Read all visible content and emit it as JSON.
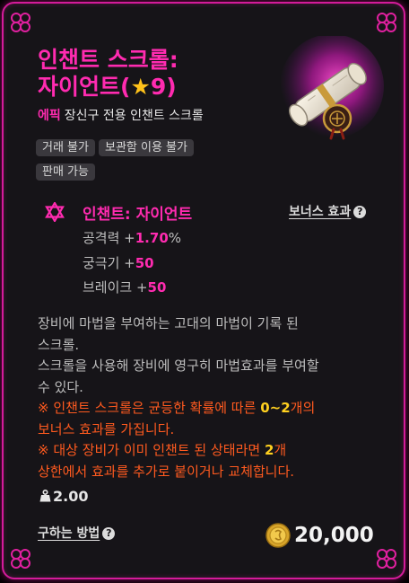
{
  "item": {
    "title_line1": "인챈트 스크롤:",
    "title_line2_prefix": "자이언트(",
    "title_star_glyph": "★",
    "title_star_level": "9",
    "title_line2_suffix": ")",
    "grade": "에픽",
    "type": "장신구 전용 인챈트 스크롤",
    "icon": "scroll-item-icon"
  },
  "tags": [
    "거래 불가",
    "보관함 이용 불가",
    "판매 가능"
  ],
  "enchant": {
    "icon": "hexagram-icon",
    "name": "인챈트: 자이언트",
    "bonus_link": "보너스 효과",
    "stats": [
      {
        "label": "공격력 +",
        "value": "1.70",
        "unit": "%"
      },
      {
        "label": "궁극기 +",
        "value": "50",
        "unit": ""
      },
      {
        "label": "브레이크 +",
        "value": "50",
        "unit": ""
      }
    ]
  },
  "description": {
    "line1": "장비에 마법을 부여하는 고대의 마법이 기록 된",
    "line2": "스크롤.",
    "line3": "스크롤을 사용해 장비에 영구히 마법효과를 부여할",
    "line4": "수 있다.",
    "warn1_a": "※ 인챈트 스크롤은 균등한 확률에 따른 ",
    "warn1_b": "0~2",
    "warn1_c": "개의",
    "warn1_d": "보너스 효과를 가집니다.",
    "warn2_a": "※ 대상 장비가 이미 인챈트 된 상태라면 ",
    "warn2_b": "2",
    "warn2_c": "개",
    "warn2_d": "상한에서 효과를 추가로 붙이거나 교체합니다."
  },
  "weight": "2.00",
  "footer": {
    "howto": "구하는 방법",
    "price": "20,000",
    "currency_icon": "gold-coin-icon"
  },
  "colors": {
    "accent": "#ff2bb0",
    "border": "#d41b9a",
    "warning": "#ff5a1f",
    "highlight": "#ffd01f",
    "background": "#161418"
  }
}
